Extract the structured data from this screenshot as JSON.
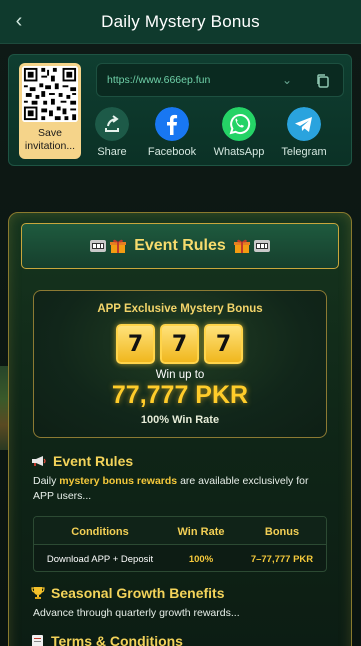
{
  "header": {
    "title": "Daily Mystery Bonus",
    "back_icon": "chevron-left-icon"
  },
  "share": {
    "qr_label": "Save invitation...",
    "url": "https://www.666ep.fun",
    "items": [
      {
        "label": "Share",
        "icon": "share-icon",
        "color": "#1d5a48"
      },
      {
        "label": "Facebook",
        "icon": "facebook-icon",
        "color": "#1877f2"
      },
      {
        "label": "WhatsApp",
        "icon": "whatsapp-icon",
        "color": "#25d366"
      },
      {
        "label": "Telegram",
        "icon": "telegram-icon",
        "color": "#2aa3de"
      }
    ]
  },
  "rules_banner": {
    "title": "Event Rules"
  },
  "bonus": {
    "title": "APP Exclusive Mystery Bonus",
    "slots": [
      "7",
      "7",
      "7"
    ],
    "win_up_to": "Win up to",
    "amount": "77,777 PKR",
    "win_rate": "100% Win Rate"
  },
  "event_rules": {
    "heading": "Event Rules",
    "text_prefix": "Daily ",
    "text_highlight": "mystery bonus rewards",
    "text_suffix": " are available exclusively for APP users..."
  },
  "table": {
    "headers": [
      "Conditions",
      "Win Rate",
      "Bonus"
    ],
    "row": [
      "Download APP + Deposit",
      "100%",
      "7–77,777 PKR"
    ]
  },
  "seasonal": {
    "heading": "Seasonal Growth Benefits",
    "text": "Advance through quarterly growth rewards..."
  },
  "terms": {
    "heading": "Terms & Conditions"
  },
  "colors": {
    "gold": "#f3d35a",
    "header_bg": "#0f3a2d",
    "accent_green": "#6fd0a8"
  }
}
